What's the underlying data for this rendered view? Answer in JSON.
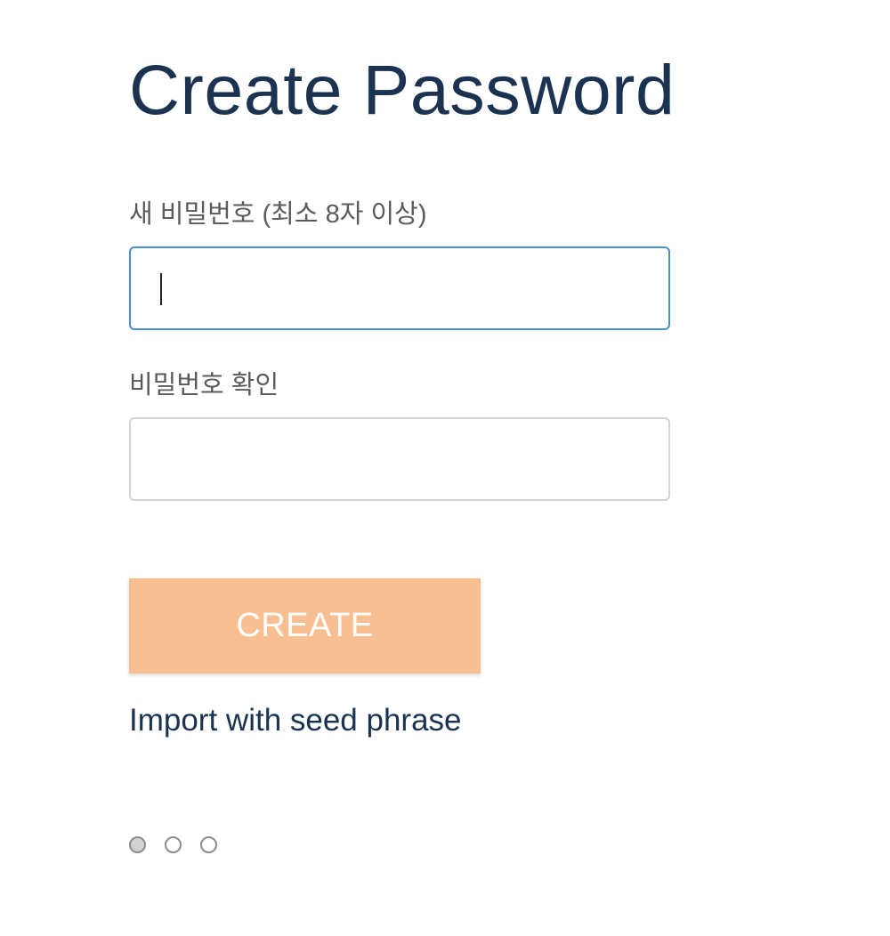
{
  "page": {
    "title": "Create Password"
  },
  "form": {
    "new_password": {
      "label": "새 비밀번호 (최소 8자 이상)",
      "value": "",
      "focused": true
    },
    "confirm_password": {
      "label": "비밀번호 확인",
      "value": ""
    },
    "create_label": "CREATE",
    "import_label": "Import with seed phrase"
  },
  "pagination": {
    "total": 3,
    "active_index": 0
  },
  "colors": {
    "title": "#1b3350",
    "button_bg": "#f8bf92",
    "focus_border": "#4a90d0"
  }
}
